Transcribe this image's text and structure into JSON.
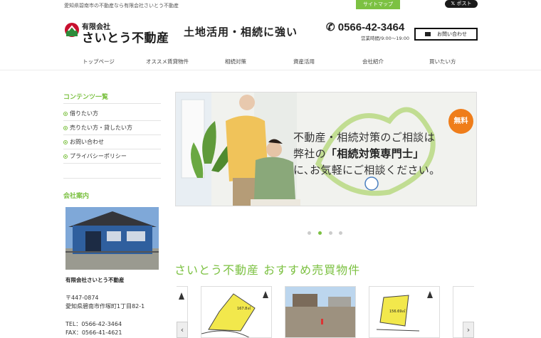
{
  "topbar": {
    "tagline": "愛知県碧南市の不動産なら有限会社さいとう不動産",
    "sitemap_label": "サイトマップ",
    "xpost_label": "ポスト"
  },
  "header": {
    "logo_sub": "有限会社",
    "logo_main": "さいとう不動産",
    "catch": "土地活用・相続に強い",
    "phone": "0566-42-3464",
    "hours": "営業時間/9:00〜19:00",
    "contact_label": "お問い合わせ"
  },
  "nav": {
    "items": [
      "トップページ",
      "オススメ賃貸物件",
      "相続対策",
      "資産活用",
      "会社紹介",
      "買いたい方"
    ]
  },
  "sidebar": {
    "title": "コンテンツ一覧",
    "links": [
      "借りたい方",
      "売りたい方・貸したい方",
      "お問い合わせ",
      "プライバシーポリシー"
    ],
    "company_title": "会社案内",
    "company_name": "有限会社さいとう不動産",
    "postal": "〒447-0874",
    "address": "愛知県碧南市作塚町1丁目82-1",
    "tel": "TEL：0566-42-3464",
    "fax": "FAX：0566-41-4621"
  },
  "hero": {
    "line1": "不動産・相続対策のご相談は",
    "line2_a": "弊社の",
    "line2_b": "「相続対策専門士」",
    "line3": "に､お気軽にご相談ください。",
    "badge": "無料"
  },
  "section": {
    "title": "さいとう不動産 おすすめ売買物件"
  },
  "carousel": {
    "prev": "‹",
    "next": "›",
    "card_area_1": "167.8㎡",
    "card_area_2": "156.69㎡"
  },
  "colors": {
    "accent": "#7cc142",
    "badge": "#ef7d1a"
  }
}
